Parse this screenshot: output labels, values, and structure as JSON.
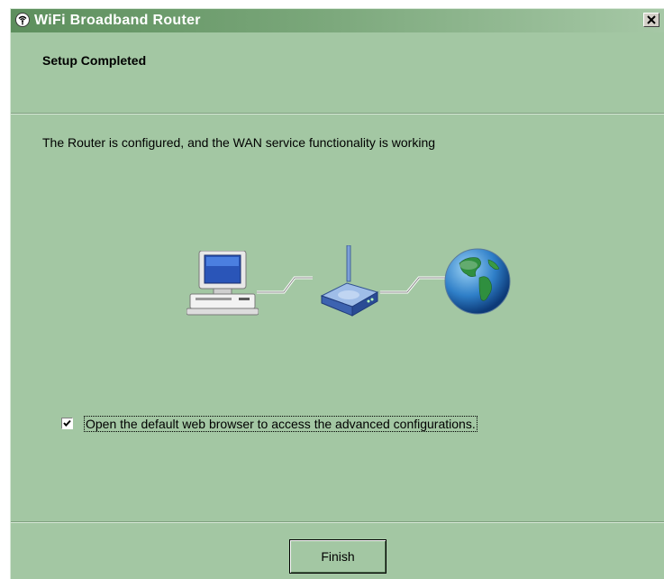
{
  "window": {
    "title": "WiFi Broadband Router",
    "app_icon": "wifi-antenna-icon",
    "close_icon": "close-x-icon"
  },
  "header": {
    "title": "Setup Completed"
  },
  "main": {
    "status_text": "The Router is configured, and the WAN service functionality is working",
    "diagram": {
      "icons": [
        "computer-icon",
        "router-icon",
        "globe-icon"
      ]
    },
    "checkbox": {
      "label": "Open the default web browser to access the advanced configurations.",
      "checked": true
    }
  },
  "footer": {
    "finish_label": "Finish"
  },
  "colors": {
    "background": "#a3c7a3",
    "titlebar_start": "#5d8f5d",
    "titlebar_end": "#a6c8a6"
  }
}
